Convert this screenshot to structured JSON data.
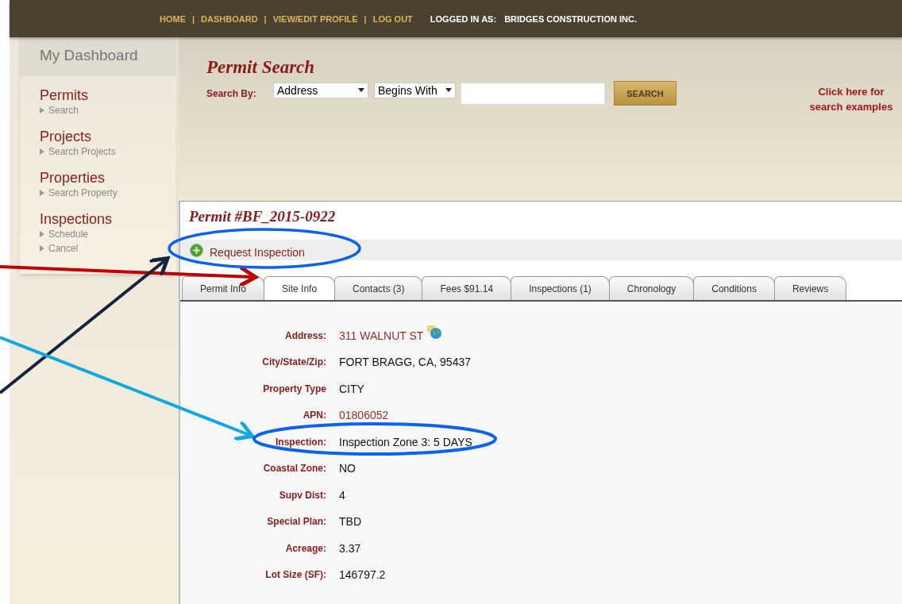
{
  "nav": {
    "items": [
      {
        "label": "HOME"
      },
      {
        "separator": "|",
        "label": "DASHBOARD"
      },
      {
        "separator": "|",
        "label": "VIEW/EDIT PROFILE"
      },
      {
        "separator": "|",
        "label": "LOG OUT"
      }
    ],
    "logged_in_label": "LOGGED IN AS:",
    "user": "BRIDGES CONSTRUCTION INC."
  },
  "sidebar": {
    "title": "My Dashboard",
    "sections": [
      {
        "title": "Permits",
        "links": [
          "Search"
        ]
      },
      {
        "title": "Projects",
        "links": [
          "Search Projects"
        ]
      },
      {
        "title": "Properties",
        "links": [
          "Search Property"
        ]
      },
      {
        "title": "Inspections",
        "links": [
          "Schedule",
          "Cancel"
        ]
      }
    ]
  },
  "search": {
    "title": "Permit Search",
    "label": "Search By:",
    "field_select": "Address",
    "match_select": "Begins With",
    "button": "SEARCH",
    "help_link": "Click here for search examples"
  },
  "permit": {
    "title": "Permit #BF_2015-0922",
    "action": "Request Inspection",
    "tabs": [
      {
        "label": "Permit Info",
        "selected": false
      },
      {
        "label": "Site Info",
        "selected": true
      },
      {
        "label": "Contacts (3)",
        "selected": false
      },
      {
        "label": "Fees $91.14",
        "selected": false
      },
      {
        "label": "Inspections (1)",
        "selected": false
      },
      {
        "label": "Chronology",
        "selected": false
      },
      {
        "label": "Conditions",
        "selected": false
      },
      {
        "label": "Reviews",
        "selected": false
      }
    ],
    "fields": [
      {
        "label": "Address:",
        "value": "311 WALNUT ST",
        "kind": "map-link"
      },
      {
        "label": "City/State/Zip:",
        "value": "FORT BRAGG, CA, 95437",
        "kind": "text"
      },
      {
        "label": "Property Type",
        "value": "CITY",
        "kind": "text"
      },
      {
        "label": "APN:",
        "value": "01806052",
        "kind": "link"
      },
      {
        "label": "Inspection:",
        "value": "Inspection Zone 3: 5 DAYS",
        "kind": "text"
      },
      {
        "label": "Coastal Zone:",
        "value": "NO",
        "kind": "text"
      },
      {
        "label": "Supv Dist:",
        "value": "4",
        "kind": "text"
      },
      {
        "label": "Special Plan:",
        "value": "TBD",
        "kind": "text"
      },
      {
        "label": "Acreage:",
        "value": "3.37",
        "kind": "text"
      },
      {
        "label": "Lot Size (SF):",
        "value": "146797.2",
        "kind": "text"
      }
    ]
  }
}
